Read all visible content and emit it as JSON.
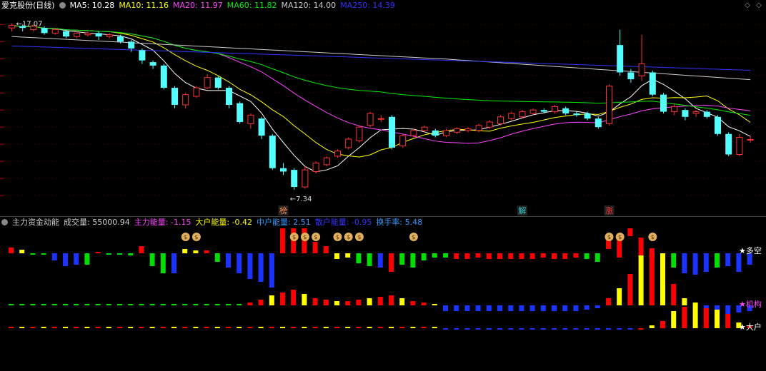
{
  "header": {
    "title": "爱克股份(日线)",
    "ma": [
      {
        "label": "MA5: 10.28",
        "color": "#ffffff"
      },
      {
        "label": "MA10: 11.16",
        "color": "#ffff00"
      },
      {
        "label": "MA20: 11.97",
        "color": "#ff44ff"
      },
      {
        "label": "MA60: 11.82",
        "color": "#00ee00"
      },
      {
        "label": "MA120: 14.00",
        "color": "#cccccc"
      },
      {
        "label": "MA250: 14.39",
        "color": "#3333ff"
      }
    ]
  },
  "price": {
    "high_label": "17.07",
    "low_label": "7.34",
    "markers": [
      {
        "text": "榜",
        "index": 25
      },
      {
        "text": "解",
        "index": 47
      },
      {
        "text": "涨",
        "index": 55
      }
    ]
  },
  "indicator": {
    "title": "主力资金动能",
    "values": [
      {
        "label": "成交量: 55000.94",
        "color": "#cccccc"
      },
      {
        "label": "主力能量: -1.15",
        "color": "#ff44ff"
      },
      {
        "label": "大户能量: -0.42",
        "color": "#ffff00"
      },
      {
        "label": "中户能量: 2.51",
        "color": "#3399ff"
      },
      {
        "label": "散户能量: -0.95",
        "color": "#3333ff"
      },
      {
        "label": "换手率: 5.48",
        "color": "#3399ff"
      }
    ],
    "right_labels": [
      {
        "text": "★多空",
        "color": "#ffffff"
      },
      {
        "text": "★机构",
        "color": "#ff44ff"
      },
      {
        "text": "★大户",
        "color": "#ffffff"
      }
    ],
    "money_icon_indices": [
      16,
      17,
      26,
      27,
      28,
      30,
      31,
      32,
      37,
      55,
      56,
      59
    ]
  },
  "chart_data": {
    "type": "candlestick",
    "y_range": [
      6.5,
      17.6
    ],
    "candles": [
      [
        16.8,
        16.95,
        16.6,
        17.07
      ],
      [
        16.9,
        16.8,
        16.6,
        17.0
      ],
      [
        16.7,
        16.9,
        16.6,
        17.0
      ],
      [
        16.8,
        16.5,
        16.4,
        16.9
      ],
      [
        16.5,
        16.7,
        16.4,
        16.8
      ],
      [
        16.6,
        16.3,
        16.2,
        16.7
      ],
      [
        16.3,
        16.5,
        16.2,
        16.6
      ],
      [
        16.4,
        16.5,
        16.3,
        16.6
      ],
      [
        16.5,
        16.3,
        16.1,
        16.6
      ],
      [
        16.3,
        16.4,
        16.2,
        16.5
      ],
      [
        16.3,
        16.0,
        15.9,
        16.4
      ],
      [
        16.0,
        15.6,
        15.4,
        16.1
      ],
      [
        15.5,
        14.9,
        14.7,
        15.6
      ],
      [
        14.8,
        14.6,
        14.4,
        14.9
      ],
      [
        14.6,
        13.3,
        13.2,
        14.7
      ],
      [
        13.3,
        12.3,
        12.1,
        13.4
      ],
      [
        12.3,
        12.9,
        12.1,
        13.0
      ],
      [
        12.8,
        13.3,
        12.7,
        13.4
      ],
      [
        13.3,
        13.9,
        13.2,
        14.1
      ],
      [
        13.9,
        13.3,
        13.2,
        14.0
      ],
      [
        13.3,
        12.3,
        12.1,
        13.4
      ],
      [
        12.4,
        11.3,
        11.2,
        12.5
      ],
      [
        11.2,
        11.7,
        10.9,
        11.8
      ],
      [
        11.5,
        10.5,
        10.3,
        11.6
      ],
      [
        10.5,
        8.6,
        8.5,
        10.6
      ],
      [
        8.6,
        8.4,
        8.2,
        8.9
      ],
      [
        8.5,
        7.5,
        7.34,
        8.6
      ],
      [
        7.5,
        8.5,
        7.4,
        8.7
      ],
      [
        8.4,
        8.9,
        8.3,
        9.0
      ],
      [
        8.8,
        9.2,
        8.7,
        9.3
      ],
      [
        9.3,
        9.6,
        9.2,
        9.7
      ],
      [
        9.8,
        10.3,
        9.7,
        10.4
      ],
      [
        10.2,
        11.0,
        10.1,
        11.1
      ],
      [
        11.1,
        11.8,
        11.0,
        11.9
      ],
      [
        11.5,
        11.5,
        11.3,
        11.7
      ],
      [
        11.6,
        9.8,
        9.7,
        11.7
      ],
      [
        9.9,
        10.5,
        9.8,
        10.6
      ],
      [
        10.5,
        10.8,
        10.4,
        10.9
      ],
      [
        10.8,
        11.0,
        10.7,
        11.1
      ],
      [
        10.8,
        10.5,
        10.4,
        10.9
      ],
      [
        10.5,
        10.8,
        10.4,
        10.9
      ],
      [
        10.7,
        10.9,
        10.6,
        11.0
      ],
      [
        10.8,
        10.9,
        10.7,
        11.0
      ],
      [
        10.8,
        11.1,
        10.7,
        11.2
      ],
      [
        11.0,
        11.3,
        10.9,
        11.4
      ],
      [
        11.2,
        11.6,
        11.1,
        11.7
      ],
      [
        11.5,
        11.8,
        11.4,
        11.9
      ],
      [
        11.6,
        11.9,
        11.5,
        12.0
      ],
      [
        11.8,
        12.0,
        11.7,
        12.1
      ],
      [
        12.0,
        11.9,
        11.8,
        12.1
      ],
      [
        11.9,
        12.2,
        11.8,
        12.3
      ],
      [
        12.1,
        11.8,
        11.7,
        12.2
      ],
      [
        11.8,
        11.7,
        11.6,
        11.9
      ],
      [
        11.8,
        11.5,
        11.4,
        11.9
      ],
      [
        11.5,
        11.0,
        10.9,
        11.6
      ],
      [
        11.2,
        13.4,
        11.1,
        13.5
      ],
      [
        15.8,
        14.2,
        14.0,
        16.7
      ],
      [
        14.2,
        13.8,
        13.6,
        14.4
      ],
      [
        14.0,
        14.7,
        13.7,
        16.4
      ],
      [
        14.2,
        12.9,
        12.8,
        14.3
      ],
      [
        12.9,
        11.9,
        11.8,
        13.0
      ],
      [
        11.9,
        12.2,
        11.7,
        12.4
      ],
      [
        12.0,
        11.6,
        11.4,
        12.1
      ],
      [
        11.8,
        11.9,
        11.6,
        12.0
      ],
      [
        11.9,
        11.6,
        11.5,
        12.0
      ],
      [
        11.6,
        10.6,
        10.5,
        11.7
      ],
      [
        10.6,
        9.4,
        9.3,
        10.7
      ],
      [
        9.4,
        10.4,
        9.3,
        10.6
      ],
      [
        10.28,
        10.28,
        10.1,
        10.5
      ]
    ],
    "volume": [
      {
        "a": 55000.94,
        "b": 55000.94
      }
    ]
  }
}
